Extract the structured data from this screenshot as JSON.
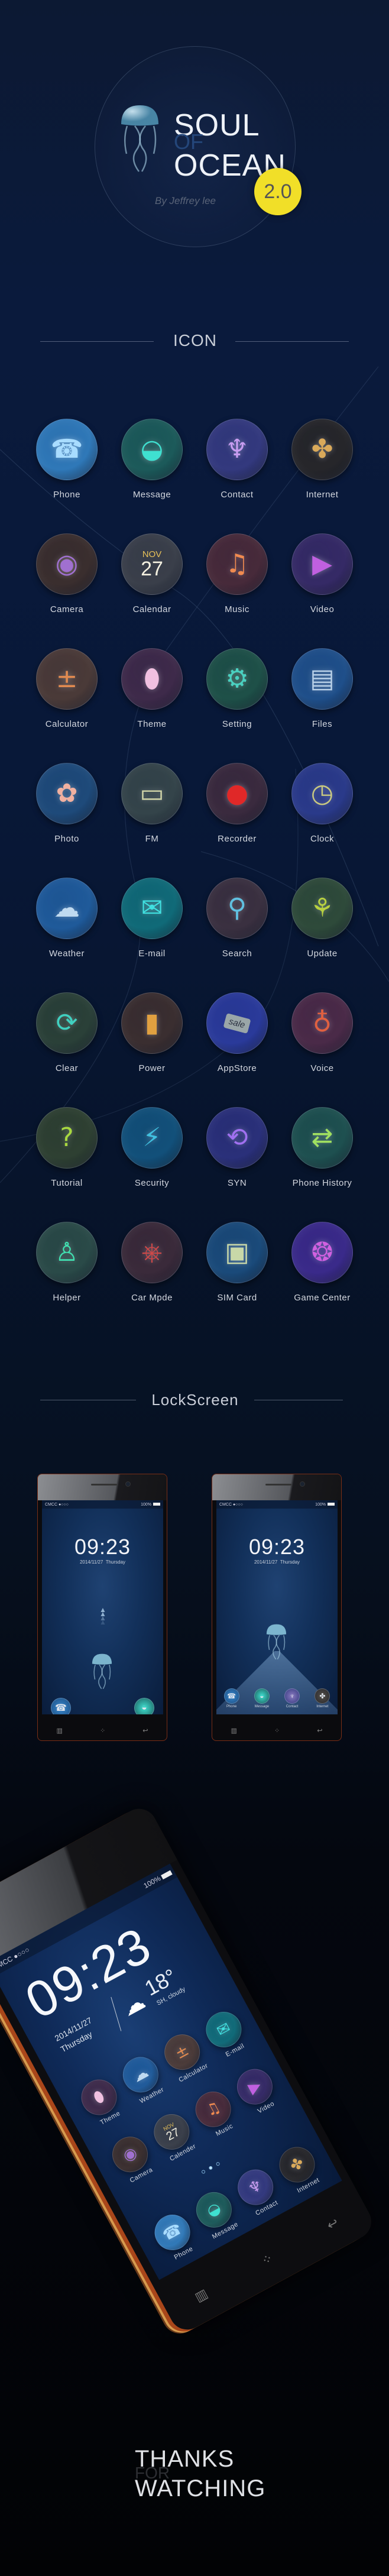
{
  "header": {
    "title_line1": "SOUL",
    "title_of": "OF",
    "title_line2": "OCEAN",
    "version": "2.0",
    "author": "By Jeffrey lee",
    "badge_color": "#f1df28"
  },
  "sections": {
    "icon": "ICON",
    "lockscreen": "LockScreen"
  },
  "icons": [
    {
      "label": "Phone",
      "icon": "phone-jellyfish-icon",
      "color": "#2f78b8",
      "accent": "#a8dcff"
    },
    {
      "label": "Message",
      "icon": "message-bubble-icon",
      "color": "#1c5a5a",
      "accent": "#3fe0d0"
    },
    {
      "label": "Contact",
      "icon": "contact-jellyfish-icon",
      "color": "#33397e",
      "accent": "#c79cf0"
    },
    {
      "label": "Internet",
      "icon": "internet-pinwheel-icon",
      "color": "#26262a",
      "accent": "#d9a95a"
    },
    {
      "label": "Camera",
      "icon": "camera-lens-icon",
      "color": "#3a2e2e",
      "accent": "#a070d0"
    },
    {
      "label": "Calendar",
      "icon": "calendar-icon",
      "color": "#3a3f4a",
      "accent": "#e8c25a",
      "month": "NOV",
      "day": "27"
    },
    {
      "label": "Music",
      "icon": "music-note-icon",
      "color": "#472a3a",
      "accent": "#f08a50"
    },
    {
      "label": "Video",
      "icon": "video-play-icon",
      "color": "#352a66",
      "accent": "#c060e0"
    },
    {
      "label": "Calculator",
      "icon": "calculator-icon",
      "color": "#4a3a38",
      "accent": "#e08a50"
    },
    {
      "label": "Theme",
      "icon": "theme-drop-icon",
      "color": "#3e2a4a",
      "accent": "#f0c0e0"
    },
    {
      "label": "Setting",
      "icon": "gear-icon",
      "color": "#1e5048",
      "accent": "#4ad0c0"
    },
    {
      "label": "Files",
      "icon": "files-icon",
      "color": "#1f4f8a",
      "accent": "#b8d0e8"
    },
    {
      "label": "Photo",
      "icon": "photo-flower-icon",
      "color": "#1e4a7a",
      "accent": "#f0b0a0"
    },
    {
      "label": "FM",
      "icon": "radio-icon",
      "color": "#34444a",
      "accent": "#d0d4a8"
    },
    {
      "label": "Recorder",
      "icon": "record-icon",
      "color": "#3a2a3e",
      "accent": "#e02828"
    },
    {
      "label": "Clock",
      "icon": "clock-icon",
      "color": "#2a3a8a",
      "accent": "#c8c880"
    },
    {
      "label": "Weather",
      "icon": "cloud-icon",
      "color": "#1f5a9a",
      "accent": "#c0daf0"
    },
    {
      "label": "E-mail",
      "icon": "envelope-icon",
      "color": "#106a78",
      "accent": "#40e0e0"
    },
    {
      "label": "Search",
      "icon": "magnifier-icon",
      "color": "#3a3040",
      "accent": "#60c0e0"
    },
    {
      "label": "Update",
      "icon": "update-jellyfish-icon",
      "color": "#2e4a3a",
      "accent": "#b8d040"
    },
    {
      "label": "Clear",
      "icon": "clear-broom-icon",
      "color": "#2a4038",
      "accent": "#40d0c0"
    },
    {
      "label": "Power",
      "icon": "battery-icon",
      "color": "#3a2e30",
      "accent": "#e0a040"
    },
    {
      "label": "AppStore",
      "icon": "sale-tag-icon",
      "color": "#2a3a9a",
      "accent": "#9aa6a8",
      "tag": "sale"
    },
    {
      "label": "Voice",
      "icon": "microphone-icon",
      "color": "#4a2a48",
      "accent": "#e06040"
    },
    {
      "label": "Tutorial",
      "icon": "question-box-icon",
      "color": "#2e4032",
      "accent": "#a8d840"
    },
    {
      "label": "Security",
      "icon": "shield-icon",
      "color": "#12507a",
      "accent": "#40c0e0"
    },
    {
      "label": "SYN",
      "icon": "sync-cloud-icon",
      "color": "#2a307a",
      "accent": "#a070f0"
    },
    {
      "label": "Phone History",
      "icon": "phone-history-icon",
      "color": "#1e5050",
      "accent": "#a0e060"
    },
    {
      "label": "Helper",
      "icon": "helper-person-icon",
      "color": "#2a4a48",
      "accent": "#40e0b0"
    },
    {
      "label": "Car Mpde",
      "icon": "steering-wheel-icon",
      "color": "#3a2a3a",
      "accent": "#d04848"
    },
    {
      "label": "SIM Card",
      "icon": "sim-card-icon",
      "color": "#1a4a7a",
      "accent": "#c8d8a8"
    },
    {
      "label": "Game Center",
      "icon": "game-bubbles-icon",
      "color": "#3a2a8a",
      "accent": "#d060e0"
    }
  ],
  "lockscreen": {
    "carrier": "CMCC",
    "battery": "100%",
    "time": "09:23",
    "date": "2014/11/27",
    "weekday": "Thursday",
    "dock": [
      "Phone",
      "Message",
      "Contact",
      "Internet"
    ]
  },
  "home_screen": {
    "carrier": "CMCC",
    "battery": "100%",
    "time": "09:23",
    "date": "2014/11/27",
    "weekday": "Thursday",
    "temperature": "18°",
    "location_weather": "SH, cloudy",
    "apps": [
      {
        "label": "Theme",
        "ref": 9
      },
      {
        "label": "Weather",
        "ref": 16
      },
      {
        "label": "Calculator",
        "ref": 8
      },
      {
        "label": "E-mail",
        "ref": 17
      },
      {
        "label": "Camera",
        "ref": 4
      },
      {
        "label": "Calender",
        "ref": 5
      },
      {
        "label": "Music",
        "ref": 6
      },
      {
        "label": "Video",
        "ref": 7
      },
      {
        "label": "Phone",
        "ref": 0
      },
      {
        "label": "Message",
        "ref": 1
      },
      {
        "label": "Contact",
        "ref": 2
      },
      {
        "label": "Internet",
        "ref": 3
      }
    ]
  },
  "footer": {
    "thanks": "THANKS",
    "for": "FOR",
    "watching": "WATCHING"
  }
}
